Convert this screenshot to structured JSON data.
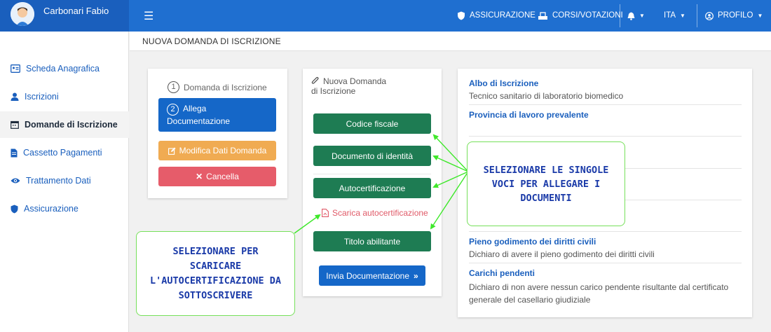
{
  "brand": {
    "user_name": "Carbonari Fabio"
  },
  "topnav": {
    "assicurazione": "ASSICURAZIONE",
    "corsi": "CORSI/VOTAZIONI",
    "language": "ITA",
    "profilo": "PROFILO"
  },
  "sidebar": {
    "items": [
      {
        "label": "Scheda Anagrafica",
        "icon": "id-card-icon"
      },
      {
        "label": "Iscrizioni",
        "icon": "user-icon"
      },
      {
        "label": "Domande di Iscrizione",
        "icon": "calendar-icon",
        "active": true
      },
      {
        "label": "Cassetto Pagamenti",
        "icon": "document-icon"
      },
      {
        "label": "Trattamento Dati",
        "icon": "eye-icon"
      },
      {
        "label": "Assicurazione",
        "icon": "shield-icon"
      }
    ]
  },
  "page": {
    "title": "NUOVA DOMANDA DI ISCRIZIONE"
  },
  "steps": {
    "step1_number": "1",
    "step1_label": "Domanda di Iscrizione",
    "step2_number": "2",
    "step2_label_line1": "Allega",
    "step2_label_line2": "Documentazione",
    "modifica": "Modifica Dati Domanda",
    "cancella": "Cancella"
  },
  "docs": {
    "title_line1": "Nuova Domanda",
    "title_line2": "di Iscrizione",
    "codice_fiscale": "Codice fiscale",
    "documento": "Documento di identità",
    "autocertificazione": "Autocertificazione",
    "scarica": "Scarica autocertificazione",
    "titolo": "Titolo abilitante",
    "invia": "Invia Documentazione"
  },
  "details": {
    "albo_label": "Albo di Iscrizione",
    "albo_value": "Tecnico sanitario di laboratorio biomedico",
    "provincia_label": "Provincia di lavoro prevalente",
    "diritti_label": "Pieno godimento dei diritti civili",
    "diritti_value": "Dichiaro di avere il pieno godimento dei diritti civili",
    "carichi_label": "Carichi pendenti",
    "carichi_value_line1": "Dichiaro di non avere nessun carico pendente risultante dal certificato",
    "carichi_value_line2": "generale del casellario giudiziale"
  },
  "callouts": {
    "right_line1": "SELEZIONARE LE SINGOLE",
    "right_line2": "VOCI PER ALLEGARE I",
    "right_line3": "DOCUMENTI",
    "left_line1": "SELEZIONARE PER",
    "left_line2": "SCARICARE",
    "left_line3": "L'AUTOCERTIFICAZIONE DA",
    "left_line4": "SOTTOSCRIVERE"
  },
  "colors": {
    "primary": "#1f6fd0",
    "green": "#1e7c53",
    "orange": "#f0ab52",
    "red": "#e65c6a",
    "callout_border": "#76e05a",
    "callout_text": "#1a3aa8"
  }
}
